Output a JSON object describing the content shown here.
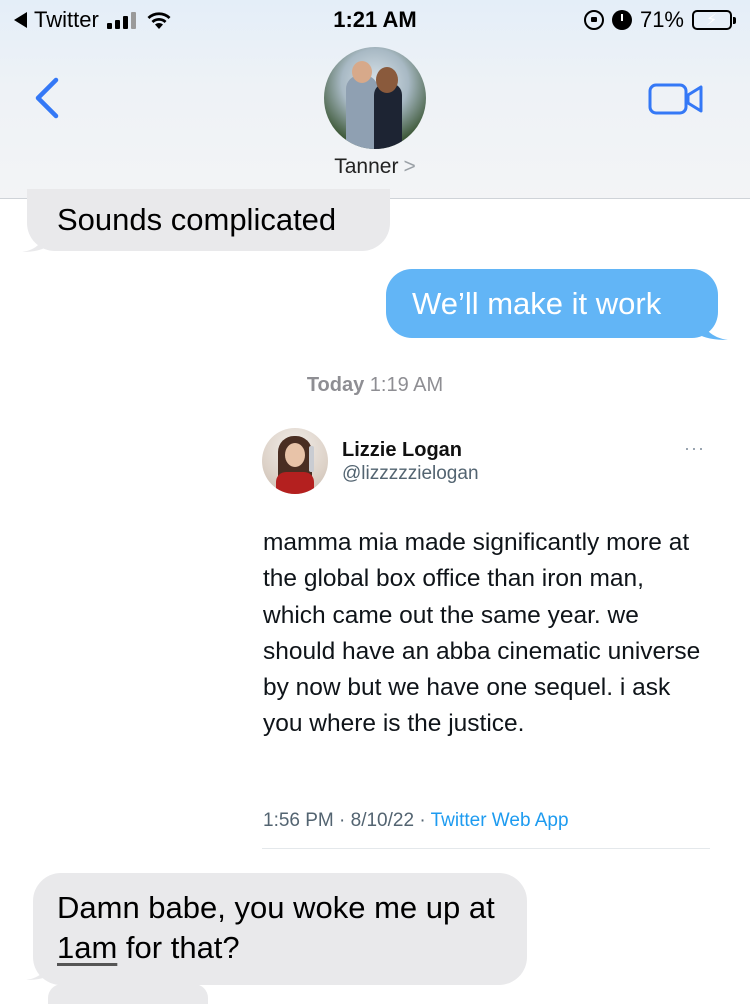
{
  "status_bar": {
    "back_app": "Twitter",
    "time": "1:21 AM",
    "battery": "71%",
    "battery_level": 0.71,
    "signal_bars": 3
  },
  "header": {
    "contact_name": "Tanner",
    "chevron": ">",
    "back_icon": "chevron-left-icon",
    "video_icon": "video-camera-icon",
    "accent": "#3478f6"
  },
  "messages": {
    "m1": "Sounds complicated",
    "m2": "We’ll make it work",
    "timestamp_day": "Today",
    "timestamp_time": "1:19 AM",
    "m3_part1": "Damn babe, you woke me up at ",
    "m3_link": "1am",
    "m3_part2": " for that?"
  },
  "tweet": {
    "name": "Lizzie Logan",
    "handle": "@lizzzzzielogan",
    "more": "···",
    "text": "mamma mia made significantly more at the global box office than iron man, which came out the same year. we should have an abba cinematic universe by now but we have one sequel. i ask you where is the justice.",
    "time": "1:56 PM · 8/10/22 · ",
    "source": "Twitter Web App"
  },
  "colors": {
    "sent_bubble": "#62b5f6",
    "received_bubble": "#e9e9eb",
    "tweet_link": "#1d9bf0"
  }
}
